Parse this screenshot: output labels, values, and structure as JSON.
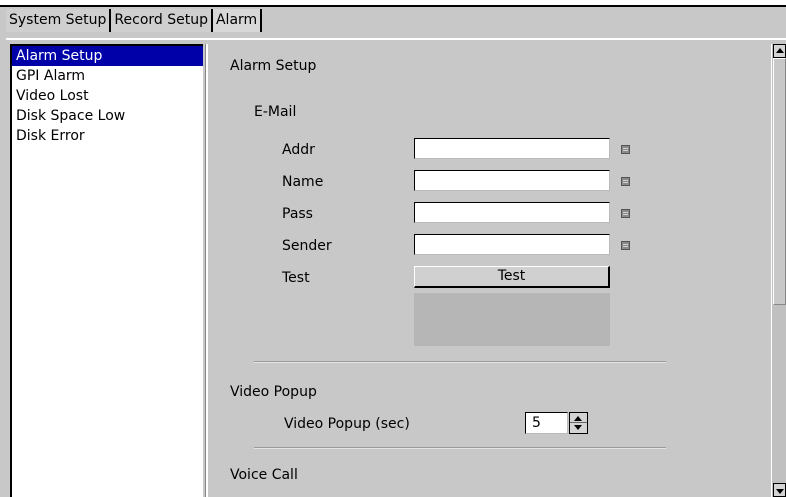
{
  "tabs": [
    "System Setup",
    "Record Setup",
    "Alarm"
  ],
  "active_tab": "Alarm",
  "sidebar": {
    "items": [
      {
        "label": "Alarm Setup",
        "selected": true
      },
      {
        "label": "GPI Alarm",
        "selected": false
      },
      {
        "label": "Video Lost",
        "selected": false
      },
      {
        "label": "Disk Space Low",
        "selected": false
      },
      {
        "label": "Disk Error",
        "selected": false
      }
    ]
  },
  "panel": {
    "title": "Alarm Setup",
    "email": {
      "section_label": "E-Mail",
      "addr_label": "Addr",
      "addr_value": "",
      "name_label": "Name",
      "name_value": "",
      "pass_label": "Pass",
      "pass_value": "",
      "sender_label": "Sender",
      "sender_value": "",
      "test_label": "Test",
      "test_button": "Test"
    },
    "video_popup": {
      "section_label": "Video Popup",
      "field_label": "Video Popup (sec)",
      "value": "5"
    },
    "voice_call": {
      "section_label": "Voice Call"
    }
  },
  "icons": {
    "keyboard": "keyboard-icon",
    "spin_up": "arrow-up-icon",
    "spin_down": "arrow-down-icon"
  },
  "colors": {
    "selection": "#0000a8",
    "background": "#c8c8c8",
    "input_background": "#ffffff"
  }
}
